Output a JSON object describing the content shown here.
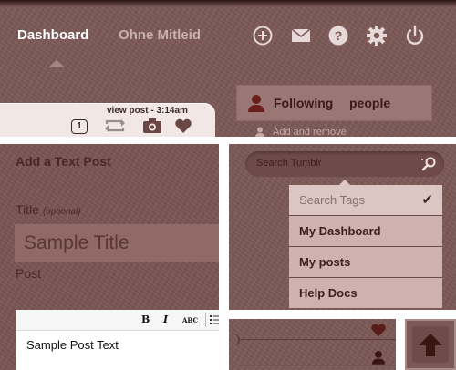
{
  "header": {
    "nav": {
      "dashboard": "Dashboard",
      "secondary": "Ohne Mitleid"
    },
    "icons": [
      "plus-circle-icon",
      "envelope-icon",
      "help-icon",
      "gear-icon",
      "power-icon"
    ],
    "post_bar": {
      "view_post_label": "view post - 3:14am",
      "count": "1"
    },
    "following": {
      "label": "Following",
      "people": "people"
    },
    "add_remove": "Add and remove"
  },
  "compose": {
    "title": "Add a Text Post",
    "title_label": "Title",
    "title_optional": "(optional)",
    "title_value": "Sample Title",
    "post_label": "Post",
    "toolbar": {
      "bold": "B",
      "italic": "I",
      "spell": "ABC"
    },
    "body_value": "Sample Post Text"
  },
  "search": {
    "placeholder": "Search Tumblr",
    "dropdown": [
      "Search Tags",
      "My Dashboard",
      "My posts",
      "Help Docs"
    ]
  },
  "colors": {
    "panel": "#7c5957",
    "light": "#f1e8e5",
    "dropdown": "#ceb2af",
    "text_dark": "#3d1f1d"
  }
}
